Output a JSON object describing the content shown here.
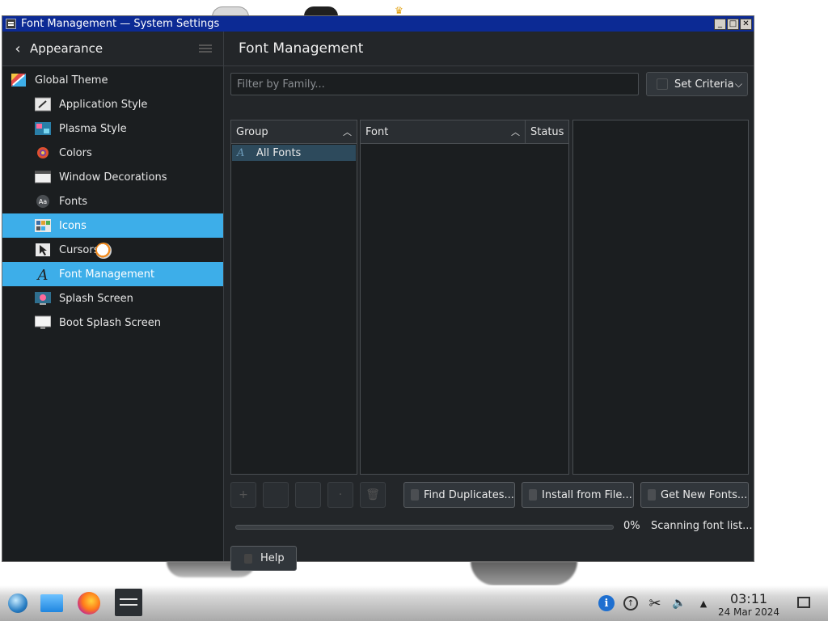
{
  "window": {
    "title": "Font Management — System Settings",
    "controls": [
      "minimize",
      "maximize",
      "close"
    ]
  },
  "sidebar": {
    "header": "Appearance",
    "items": [
      {
        "label": "Global Theme",
        "icon": "global-theme-icon",
        "level": 0,
        "active": false
      },
      {
        "label": "Application Style",
        "icon": "application-style-icon",
        "level": 1,
        "active": false
      },
      {
        "label": "Plasma Style",
        "icon": "plasma-style-icon",
        "level": 1,
        "active": false
      },
      {
        "label": "Colors",
        "icon": "colors-icon",
        "level": 1,
        "active": false
      },
      {
        "label": "Window Decorations",
        "icon": "window-decorations-icon",
        "level": 1,
        "active": false
      },
      {
        "label": "Fonts",
        "icon": "fonts-icon",
        "level": 1,
        "active": false
      },
      {
        "label": "Icons",
        "icon": "icons-icon",
        "level": 1,
        "active": true
      },
      {
        "label": "Cursors",
        "icon": "cursors-icon",
        "level": 1,
        "active": false
      },
      {
        "label": "Font Management",
        "icon": "font-management-icon",
        "level": 1,
        "active": true
      },
      {
        "label": "Splash Screen",
        "icon": "splash-screen-icon",
        "level": 1,
        "active": false
      },
      {
        "label": "Boot Splash Screen",
        "icon": "boot-splash-screen-icon",
        "level": 1,
        "active": false
      }
    ]
  },
  "main": {
    "title": "Font Management",
    "filter_placeholder": "Filter by Family...",
    "criteria_label": "Set Criteria",
    "group_header": "Group",
    "groups": [
      "All Fonts"
    ],
    "font_header": "Font",
    "status_header": "Status",
    "buttons": {
      "find_duplicates": "Find Duplicates...",
      "install_from_file": "Install from File...",
      "get_new_fonts": "Get New Fonts...",
      "help": "Help"
    },
    "progress": {
      "percent_text": "0%",
      "value": 0,
      "status": "Scanning font list..."
    }
  },
  "taskbar": {
    "time": "03:11",
    "date": "24 Mar 2024"
  },
  "colors": {
    "accent": "#3daee9",
    "window_bg": "#232629",
    "titlebar": "#0c2a94"
  }
}
